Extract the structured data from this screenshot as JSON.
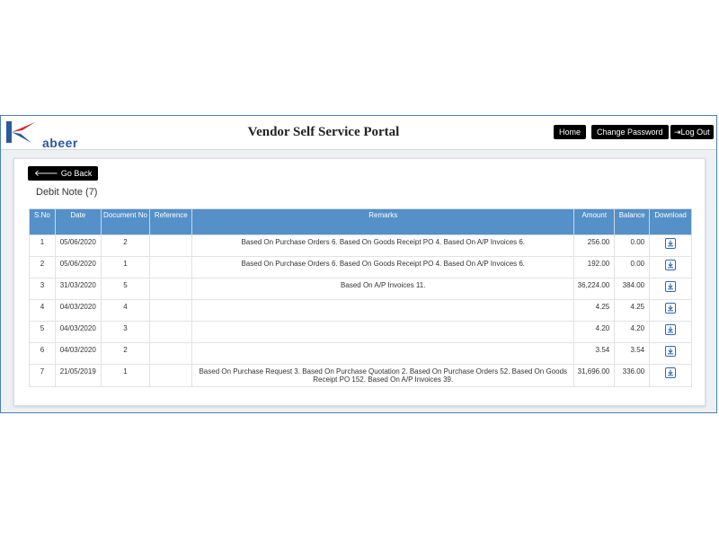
{
  "header": {
    "logo_text": "abeer",
    "portal_title": "Vendor Self Service Portal",
    "nav": {
      "home": "Home",
      "change_password": "Change Password",
      "logout": "Log Out"
    }
  },
  "page": {
    "back_label": "Go Back",
    "section_title": "Debit Note (7)"
  },
  "table": {
    "columns": [
      "S.No",
      "Date",
      "Document No",
      "Reference",
      "Remarks",
      "Amount",
      "Balance",
      "Download"
    ],
    "rows": [
      {
        "sno": "1",
        "date": "05/06/2020",
        "doc": "2",
        "ref": "",
        "remarks": "Based On Purchase Orders 6. Based On Goods Receipt PO 4. Based On A/P Invoices 6.",
        "amount": "256.00",
        "balance": "0.00"
      },
      {
        "sno": "2",
        "date": "05/06/2020",
        "doc": "1",
        "ref": "",
        "remarks": "Based On Purchase Orders 6. Based On Goods Receipt PO 4. Based On A/P Invoices 6.",
        "amount": "192.00",
        "balance": "0.00"
      },
      {
        "sno": "3",
        "date": "31/03/2020",
        "doc": "5",
        "ref": "",
        "remarks": "Based On A/P Invoices 11.",
        "amount": "36,224.00",
        "balance": "384.00"
      },
      {
        "sno": "4",
        "date": "04/03/2020",
        "doc": "4",
        "ref": "",
        "remarks": "",
        "amount": "4.25",
        "balance": "4.25"
      },
      {
        "sno": "5",
        "date": "04/03/2020",
        "doc": "3",
        "ref": "",
        "remarks": "",
        "amount": "4.20",
        "balance": "4.20"
      },
      {
        "sno": "6",
        "date": "04/03/2020",
        "doc": "2",
        "ref": "",
        "remarks": "",
        "amount": "3.54",
        "balance": "3.54"
      },
      {
        "sno": "7",
        "date": "21/05/2019",
        "doc": "1",
        "ref": "",
        "remarks": "Based On Purchase Request 3. Based On Purchase Quotation 2. Based On Purchase Orders 52. Based On Goods Receipt PO 152. Based On A/P Invoices 39.",
        "amount": "31,696.00",
        "balance": "336.00"
      }
    ]
  },
  "icons": {
    "download": "download-icon",
    "back": "arrow-left-icon",
    "logout": "sign-out-icon"
  },
  "colors": {
    "header_blue": "#5590c8",
    "button_black": "#000000",
    "logo_red": "#d42a2a",
    "logo_blue": "#2a5a9b"
  }
}
